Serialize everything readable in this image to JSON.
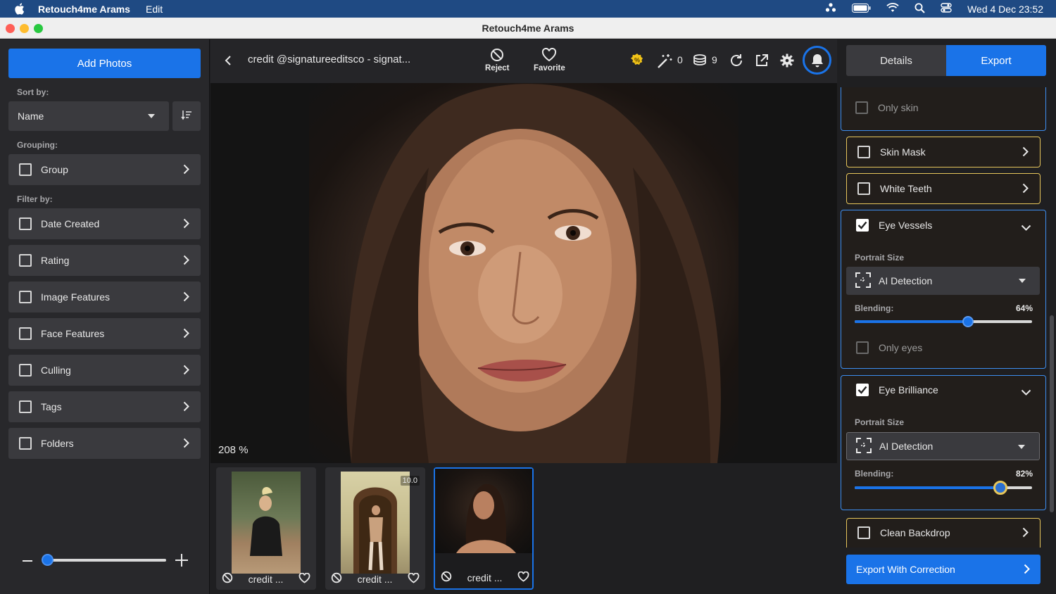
{
  "menubar": {
    "app_name": "Retouch4me Arams",
    "menu_edit": "Edit",
    "clock": "Wed 4 Dec  23:52"
  },
  "window": {
    "title": "Retouch4me Arams"
  },
  "sidebar": {
    "add_photos": "Add Photos",
    "sort_label": "Sort by:",
    "sort_value": "Name",
    "grouping_label": "Grouping:",
    "group_item": "Group",
    "filter_label": "Filter by:",
    "filters": [
      "Date Created",
      "Rating",
      "Image Features",
      "Face Features",
      "Culling",
      "Tags",
      "Folders"
    ],
    "thumb_size_level": 0.02
  },
  "toolbar": {
    "filename": "credit @signatureeditsco - signat...",
    "reject_label": "Reject",
    "favorite_label": "Favorite",
    "wand_count": "0",
    "coins_count": "9"
  },
  "viewer": {
    "zoom": "208 %"
  },
  "filmstrip": {
    "thumbs": [
      {
        "caption": "credit ...",
        "badge": ""
      },
      {
        "caption": "credit ...",
        "badge": "10.0"
      },
      {
        "caption": "credit ...",
        "badge": ""
      }
    ]
  },
  "panel": {
    "tab_details": "Details",
    "tab_export": "Export",
    "only_skin": "Only skin",
    "skin_mask": "Skin Mask",
    "white_teeth": "White Teeth",
    "eye_vessels": {
      "label": "Eye Vessels",
      "portrait_size_label": "Portrait Size",
      "portrait_size_value": "AI Detection",
      "blending_label": "Blending:",
      "blending_value": "64%",
      "blending": 64,
      "only_eyes": "Only eyes"
    },
    "eye_brilliance": {
      "label": "Eye Brilliance",
      "portrait_size_label": "Portrait Size",
      "portrait_size_value": "AI Detection",
      "blending_label": "Blending:",
      "blending_value": "82%",
      "blending": 82
    },
    "clean_backdrop": "Clean Backdrop",
    "export_button": "Export With Correction"
  },
  "colors": {
    "accent": "#1a73e8",
    "highlight_border": "#e7c65b",
    "menubar": "#1f4a83"
  }
}
